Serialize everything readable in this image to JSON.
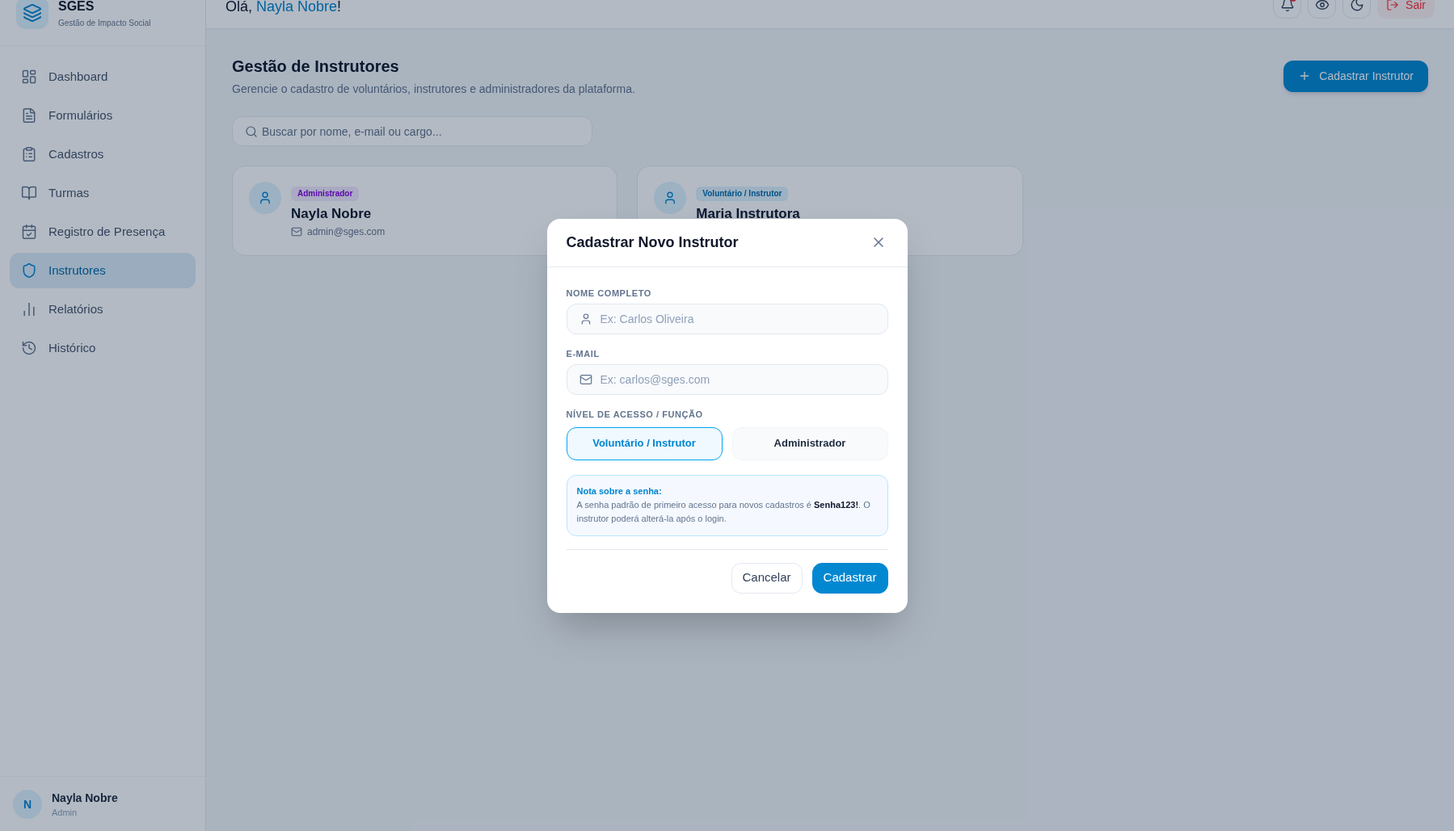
{
  "sidebar": {
    "brand": {
      "name": "SGES",
      "subtitle": "Gestão de Impacto Social"
    },
    "nav_items": [
      {
        "label": "Dashboard",
        "selected": false
      },
      {
        "label": "Formulários",
        "selected": false
      },
      {
        "label": "Cadastros",
        "selected": false
      },
      {
        "label": "Turmas",
        "selected": false
      },
      {
        "label": "Registro de Presença",
        "selected": false
      },
      {
        "label": "Instrutores",
        "selected": true
      },
      {
        "label": "Relatórios",
        "selected": false
      },
      {
        "label": "Histórico",
        "selected": false
      }
    ],
    "user": {
      "initial": "N",
      "name": "Nayla Nobre",
      "role": "Admin"
    }
  },
  "header": {
    "greeting": "Olá,",
    "user_name": "Nayla Nobre",
    "greeting_end": "!",
    "notifications_unread": true,
    "logout_label": "Sair"
  },
  "page": {
    "title": "Gestão de Instrutores",
    "subtitle": "Gerencie o cadastro de voluntários, instrutores e administradores da plataforma.",
    "add_button": "Cadastrar Instrutor",
    "search": {
      "placeholder": "Buscar por nome, e-mail ou cargo..."
    },
    "instructors": [
      {
        "kind": "admin",
        "role": "Administrador",
        "name": "Nayla Nobre",
        "email": "admin@sges.com"
      },
      {
        "kind": "instructor",
        "role": "Voluntário / Instrutor",
        "name": "Maria Instrutora"
      }
    ]
  },
  "modal": {
    "title": "Cadastrar Novo Instrutor",
    "fields": [
      {
        "label": "NOME COMPLETO",
        "placeholder": "Ex: Carlos Oliveira"
      },
      {
        "label": "E-MAIL",
        "placeholder": "Ex: carlos@sges.com"
      }
    ],
    "role_label": "NÍVEL DE ACESSO / FUNÇÃO",
    "role_options": [
      {
        "label": "Voluntário / Instrutor",
        "selected": true
      },
      {
        "label": "Administrador",
        "selected": false
      }
    ],
    "note": {
      "title": "Nota sobre a senha:",
      "text": "A senha padrão de primeiro acesso para novos cadastros é **Senha123!**. O instrutor poderá alterá-la após o login."
    },
    "buttons": [
      {
        "label": "Cancelar",
        "kind": "secondary"
      },
      {
        "label": "Cadastrar",
        "kind": "primary"
      }
    ]
  }
}
